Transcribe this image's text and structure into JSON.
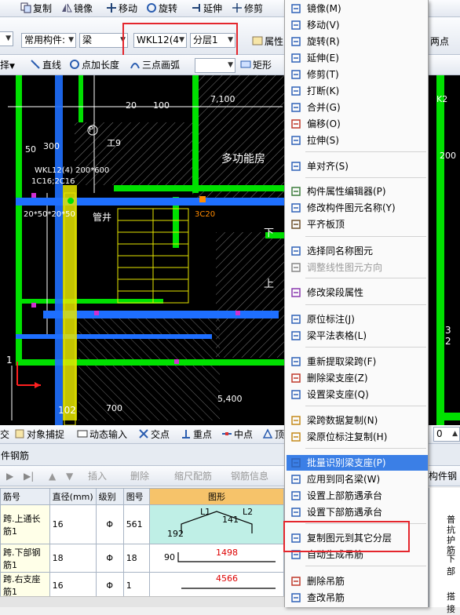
{
  "toolbar1": {
    "copy": "复制",
    "mirror": "镜像",
    "move": "移动",
    "rotate": "旋转",
    "extend": "延伸",
    "trim": "修剪"
  },
  "toolbar2": {
    "type_combo": "常用构件:",
    "category_combo": "梁",
    "element_combo": "WKL12(4",
    "layer_combo": "分层1",
    "attr_label": "属性",
    "two_point": "两点"
  },
  "toolbar3": {
    "select_label": "择",
    "line_label": "直线",
    "point_len_label": "点加长度",
    "arc_label": "三点画弧",
    "rect_label": "矩形"
  },
  "snapbar": {
    "intersect": "交",
    "object_snap": "对象捕捉",
    "dynamic_input": "动态输入",
    "cross_point": "交点",
    "perp_point": "重点",
    "mid_point": "中点",
    "top_point": "顶",
    "spin_value": "0"
  },
  "rebar_panel": {
    "title": "件钢筋",
    "insert": "插入",
    "delete": "删除",
    "scale": "缩尺配筋",
    "rebar_info": "钢筋信息",
    "other_rebar": "构件钢",
    "headers": [
      "筋号",
      "直径(mm)",
      "级别",
      "图号",
      "图形"
    ],
    "rows": [
      {
        "name": "跨.上通长",
        "name2": "筋1",
        "dia": "16",
        "grade": "Φ",
        "fig": "561",
        "shape_l1": "L1",
        "shape_mid": "141",
        "shape_l2": "L2",
        "shape_left": "192",
        "right_note": "普抗",
        "right_note2": "护筋"
      },
      {
        "name": "跨.下部钢",
        "name2": "筋1",
        "dia": "18",
        "grade": "Φ",
        "fig": "18",
        "shape_left": "90",
        "shape_len": "1498",
        "right_note": "下部"
      },
      {
        "name": "跨.右支座",
        "name2": "筋1",
        "dia": "16",
        "grade": "Φ",
        "fig": "1",
        "shape_len": "4566",
        "right_note": "搭接"
      }
    ]
  },
  "canvas_labels": {
    "dim1": "20",
    "dim2": "100",
    "dim3": "7,100",
    "dim4": "50",
    "dim5": "300",
    "k2": "K2",
    "dim6": "200",
    "p_label": "P",
    "jiu": "工9",
    "wkl": "WKL12(4) 200*600",
    "sub": "1C16;2C16",
    "n20": "20*50*20*50",
    "guanjing": "管井",
    "c20": "3C20",
    "room": "多功能房",
    "xia": "下",
    "shang": "上",
    "d700": "700",
    "d5400": "5,400",
    "d102": "102",
    "d1": "1",
    "d3": "3",
    "d2": "2"
  },
  "context_menu": {
    "items": [
      {
        "label": "镜像(M)",
        "icon": "mirror-icon"
      },
      {
        "label": "移动(V)",
        "icon": "move-icon"
      },
      {
        "label": "旋转(R)",
        "icon": "rotate-icon"
      },
      {
        "label": "延伸(E)",
        "icon": "extend-icon"
      },
      {
        "label": "修剪(T)",
        "icon": "trim-icon"
      },
      {
        "label": "打断(K)",
        "icon": "break-icon"
      },
      {
        "label": "合并(G)",
        "icon": "merge-icon"
      },
      {
        "label": "偏移(O)",
        "icon": "offset-icon"
      },
      {
        "label": "拉伸(S)",
        "icon": "stretch-icon"
      },
      {
        "label": "单对齐(S)",
        "icon": "align-icon"
      },
      {
        "label": "构件属性编辑器(P)",
        "icon": "property-editor-icon"
      },
      {
        "label": "修改构件图元名称(Y)",
        "icon": "rename-icon"
      },
      {
        "label": "平齐板顶",
        "icon": "flush-slab-icon"
      },
      {
        "label": "选择同名称图元",
        "icon": "select-same-icon"
      },
      {
        "label": "调整线性图元方向",
        "icon": "direction-icon"
      },
      {
        "label": "修改梁段属性",
        "icon": "beam-segment-icon"
      },
      {
        "label": "原位标注(J)",
        "icon": "in-situ-icon"
      },
      {
        "label": "梁平法表格(L)",
        "icon": "beam-table-icon"
      },
      {
        "label": "重新提取梁跨(F)",
        "icon": "extract-span-icon"
      },
      {
        "label": "删除梁支座(Z)",
        "icon": "delete-support-icon"
      },
      {
        "label": "设置梁支座(Q)",
        "icon": "set-support-icon"
      },
      {
        "label": "梁跨数据复制(N)",
        "icon": "span-copy-icon"
      },
      {
        "label": "梁原位标注复制(H)",
        "icon": "label-copy-icon"
      },
      {
        "label": "批量识别梁支座(P)",
        "icon": "batch-support-icon"
      },
      {
        "label": "应用到同名梁(W)",
        "icon": "apply-same-icon"
      },
      {
        "label": "设置上部筋遇承台",
        "icon": "top-rebar-icon"
      },
      {
        "label": "设置下部筋遇承台",
        "icon": "bottom-rebar-icon"
      },
      {
        "label": "复制图元到其它分层",
        "icon": "copy-layer-icon"
      },
      {
        "label": "自动生成吊筋",
        "icon": "auto-hanger-icon"
      },
      {
        "label": "删除吊筋",
        "icon": "delete-hanger-icon"
      },
      {
        "label": "查改吊筋",
        "icon": "edit-hanger-icon"
      }
    ]
  },
  "colors": {
    "accent_highlight": "#3b7fe6",
    "annotation_red": "#e4262d",
    "cad_green": "#00e000",
    "cad_blue": "#1e6fff",
    "cad_yellow": "#e6e600"
  }
}
